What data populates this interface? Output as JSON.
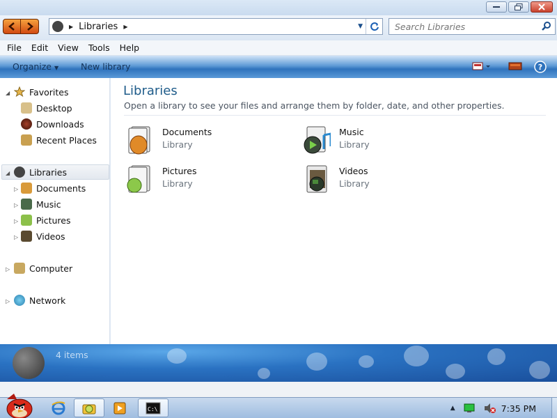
{
  "window": {
    "minimize_icon": "minimize-icon",
    "maximize_icon": "restore-icon",
    "close_icon": "close-icon"
  },
  "address_bar": {
    "location": "Libraries",
    "refresh_icon": "refresh-icon"
  },
  "search": {
    "placeholder": "Search Libraries"
  },
  "menu": {
    "items": [
      "File",
      "Edit",
      "View",
      "Tools",
      "Help"
    ]
  },
  "command_bar": {
    "organize_label": "Organize",
    "new_library_label": "New library"
  },
  "nav_pane": {
    "favorites": "Favorites",
    "favorites_items": [
      "Desktop",
      "Downloads",
      "Recent Places"
    ],
    "libraries": "Libraries",
    "libraries_items": [
      "Documents",
      "Music",
      "Pictures",
      "Videos"
    ],
    "computer": "Computer",
    "network": "Network"
  },
  "content": {
    "title": "Libraries",
    "subtitle": "Open a library to see your files and arrange them by folder, date, and other properties.",
    "libraries": [
      {
        "name": "Documents",
        "type": "Library"
      },
      {
        "name": "Music",
        "type": "Library"
      },
      {
        "name": "Pictures",
        "type": "Library"
      },
      {
        "name": "Videos",
        "type": "Library"
      }
    ]
  },
  "details": {
    "count": "4 items"
  },
  "taskbar": {
    "clock": "7:35 PM"
  },
  "colors": {
    "accent": "#2f73bd",
    "title_text": "#1f5c8a",
    "nav_button": "#e2701f"
  }
}
